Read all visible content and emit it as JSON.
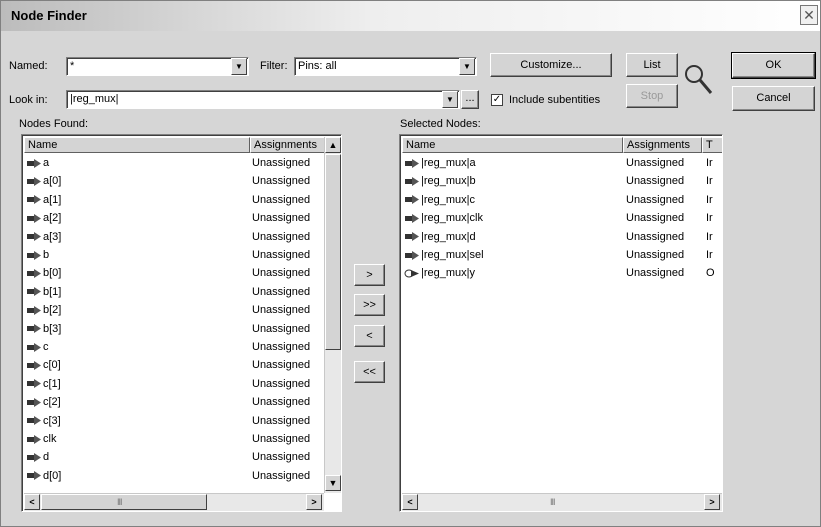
{
  "dialog": {
    "title": "Node Finder",
    "close_glyph": "✕",
    "named_label": "Named:",
    "named_value": "*",
    "filter_label": "Filter:",
    "filter_value": "Pins: all",
    "customize_label": "Customize...",
    "list_label": "List",
    "stop_label": "Stop",
    "ok_label": "OK",
    "cancel_label": "Cancel",
    "lookin_label": "Look in:",
    "lookin_value": "|reg_mux|",
    "browse_label": "...",
    "include_subentities_label": "Include subentities",
    "include_subentities_checked": true,
    "check_glyph": "✓",
    "nodes_found_label": "Nodes Found:",
    "selected_nodes_label": "Selected Nodes:",
    "move_buttons": [
      ">",
      ">>",
      "<",
      "<<"
    ],
    "search_icon": "magnifier-icon"
  },
  "nodes_found": {
    "columns": [
      "Name",
      "Assignments"
    ],
    "rows": [
      {
        "name": "a",
        "assign": "Unassigned",
        "kind": "in"
      },
      {
        "name": "a[0]",
        "assign": "Unassigned",
        "kind": "in"
      },
      {
        "name": "a[1]",
        "assign": "Unassigned",
        "kind": "in"
      },
      {
        "name": "a[2]",
        "assign": "Unassigned",
        "kind": "in"
      },
      {
        "name": "a[3]",
        "assign": "Unassigned",
        "kind": "in"
      },
      {
        "name": "b",
        "assign": "Unassigned",
        "kind": "in"
      },
      {
        "name": "b[0]",
        "assign": "Unassigned",
        "kind": "in"
      },
      {
        "name": "b[1]",
        "assign": "Unassigned",
        "kind": "in"
      },
      {
        "name": "b[2]",
        "assign": "Unassigned",
        "kind": "in"
      },
      {
        "name": "b[3]",
        "assign": "Unassigned",
        "kind": "in"
      },
      {
        "name": "c",
        "assign": "Unassigned",
        "kind": "in"
      },
      {
        "name": "c[0]",
        "assign": "Unassigned",
        "kind": "in"
      },
      {
        "name": "c[1]",
        "assign": "Unassigned",
        "kind": "in"
      },
      {
        "name": "c[2]",
        "assign": "Unassigned",
        "kind": "in"
      },
      {
        "name": "c[3]",
        "assign": "Unassigned",
        "kind": "in"
      },
      {
        "name": "clk",
        "assign": "Unassigned",
        "kind": "in"
      },
      {
        "name": "d",
        "assign": "Unassigned",
        "kind": "in"
      },
      {
        "name": "d[0]",
        "assign": "Unassigned",
        "kind": "in"
      }
    ]
  },
  "selected_nodes": {
    "columns": [
      "Name",
      "Assignments",
      "T"
    ],
    "rows": [
      {
        "name": "|reg_mux|a",
        "assign": "Unassigned",
        "type": "Ir",
        "kind": "in"
      },
      {
        "name": "|reg_mux|b",
        "assign": "Unassigned",
        "type": "Ir",
        "kind": "in"
      },
      {
        "name": "|reg_mux|c",
        "assign": "Unassigned",
        "type": "Ir",
        "kind": "in"
      },
      {
        "name": "|reg_mux|clk",
        "assign": "Unassigned",
        "type": "Ir",
        "kind": "in"
      },
      {
        "name": "|reg_mux|d",
        "assign": "Unassigned",
        "type": "Ir",
        "kind": "in"
      },
      {
        "name": "|reg_mux|sel",
        "assign": "Unassigned",
        "type": "Ir",
        "kind": "in"
      },
      {
        "name": "|reg_mux|y",
        "assign": "Unassigned",
        "type": "O",
        "kind": "out"
      }
    ]
  },
  "scroll": {
    "up": "▲",
    "down": "▼",
    "left": "<",
    "right": ">",
    "grip": "III"
  }
}
